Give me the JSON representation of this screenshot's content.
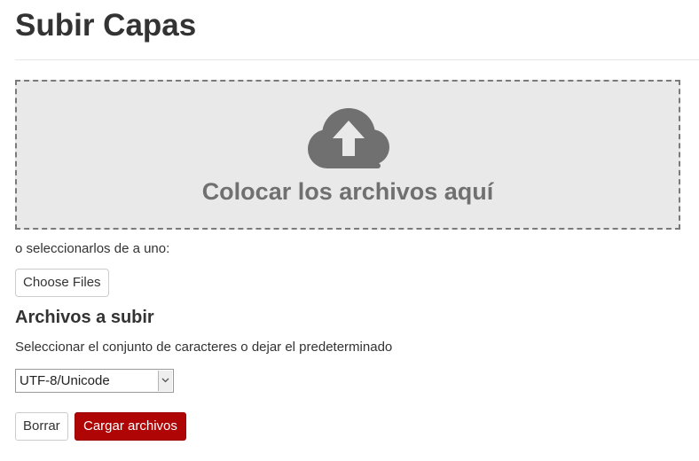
{
  "page": {
    "title": "Subir Capas"
  },
  "dropzone": {
    "icon": "cloud-upload-icon",
    "text": "Colocar los archivos aquí",
    "background_color": "#e9e9e9",
    "icon_color": "#707070"
  },
  "file_picker": {
    "hint": "o seleccionarlos de a uno:",
    "button_label": "Choose Files"
  },
  "files_section": {
    "title": "Archivos a subir"
  },
  "charset": {
    "label": "Seleccionar el conjunto de caracteres o dejar el predeterminado",
    "selected": "UTF-8/Unicode",
    "arrow_icon": "chevron-down-icon"
  },
  "actions": {
    "clear_label": "Borrar",
    "upload_label": "Cargar archivos",
    "upload_color": "#b00505"
  }
}
